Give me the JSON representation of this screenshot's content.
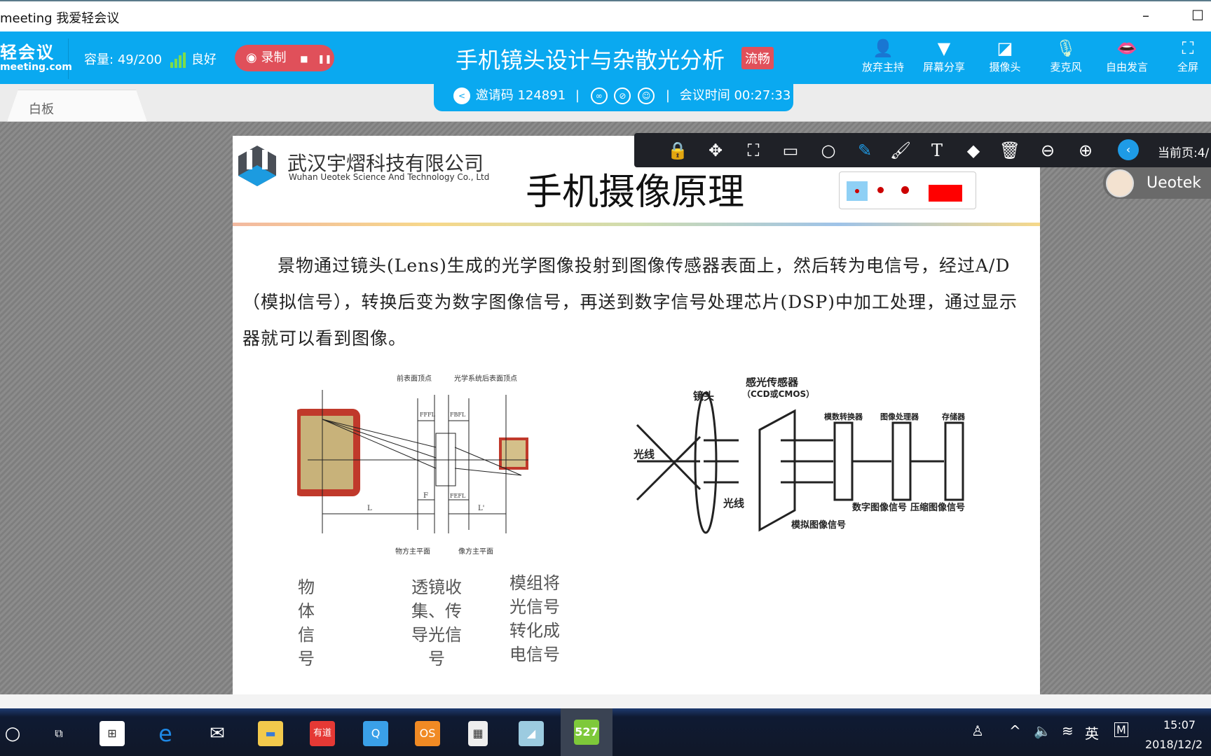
{
  "window": {
    "title": "meeting 我爱轻会议",
    "minimize": "–",
    "maximize": "☐"
  },
  "header": {
    "logo_cn": "轻会议",
    "logo_en": "meeting.com",
    "capacity_label": "容量:",
    "capacity_value": "49/200",
    "signal_text": "良好",
    "record_label": "录制",
    "record_stop": "■",
    "record_pause": "❚❚",
    "meeting_title": "手机镜头设计与杂散光分析",
    "quality_badge": "流畅",
    "buttons": [
      {
        "label": "放弃主持",
        "icon": "user-icon"
      },
      {
        "label": "屏幕分享",
        "icon": "screen-share-icon"
      },
      {
        "label": "摄像头",
        "icon": "camera-off-icon"
      },
      {
        "label": "麦克风",
        "icon": "microphone-icon"
      },
      {
        "label": "自由发言",
        "icon": "free-speech-icon"
      },
      {
        "label": "全屏",
        "icon": "fullscreen-icon"
      }
    ]
  },
  "tabs": [
    {
      "label": "白板"
    }
  ],
  "invite": {
    "code_label": "邀请码 124891",
    "sep": "|",
    "time_label": "会议时间 00:27:33"
  },
  "toolbar": {
    "tools": [
      "lock",
      "move",
      "fit",
      "rectangle",
      "circle",
      "pen",
      "brush",
      "text",
      "eraser",
      "delete",
      "zoom-out",
      "zoom-in"
    ],
    "active": "pen",
    "page_label": "当前页:4/"
  },
  "pen_popup": {
    "sizes": [
      "small",
      "medium",
      "large"
    ],
    "selected_size": "small",
    "color": "#ff0000"
  },
  "user": {
    "name": "Ueotek"
  },
  "slide": {
    "company_cn": "武汉宇熠科技有限公司",
    "company_en": "Wuhan Ueotek Science And Technology Co., Ltd",
    "title": "手机摄像原理",
    "paragraph": "景物通过镜头(Lens)生成的光学图像投射到图像传感器表面上，然后转为电信号，经过A/D（模拟信号），转换后变为数字图像信号，再送到数字信号处理芯片(DSP)中加工处理，通过显示器就可以看到图像。",
    "left_diagram": {
      "front_vertex": "前表面顶点",
      "back_vertex": "光学系统后表面顶点",
      "object_plane": "物方主平面",
      "image_plane": "像方主平面",
      "ffl": "FFFL",
      "bfl": "FBFL",
      "f": "F",
      "efl": "FEFL",
      "L": "L",
      "L2": "L'"
    },
    "right_diagram": {
      "lens": "镜头",
      "sensor": "感光传感器",
      "sensor_type": "（CCD或CMOS）",
      "light1": "光线",
      "light2": "光线",
      "analog": "模拟图像信号",
      "adc": "模数转换器",
      "digital": "数字图像信号",
      "processor": "图像处理器",
      "compressed": "压缩图像信号",
      "storage": "存储器"
    },
    "labels": [
      "物体信号",
      "透镜收集、传导光信号",
      "模组将光信号转化成电信号"
    ]
  },
  "taskbar": {
    "apps": [
      "cortana",
      "task-view",
      "store",
      "edge",
      "mail",
      "explorer",
      "youdao",
      "qq",
      "os",
      "calculator",
      "notes",
      "527meeting"
    ],
    "ime": "英",
    "time": "15:07",
    "date": "2018/12/2"
  },
  "colors": {
    "brand": "#0aa9f0",
    "record": "#e0505a",
    "toolbar": "#1f2127",
    "active_tool": "#1e9be6"
  }
}
